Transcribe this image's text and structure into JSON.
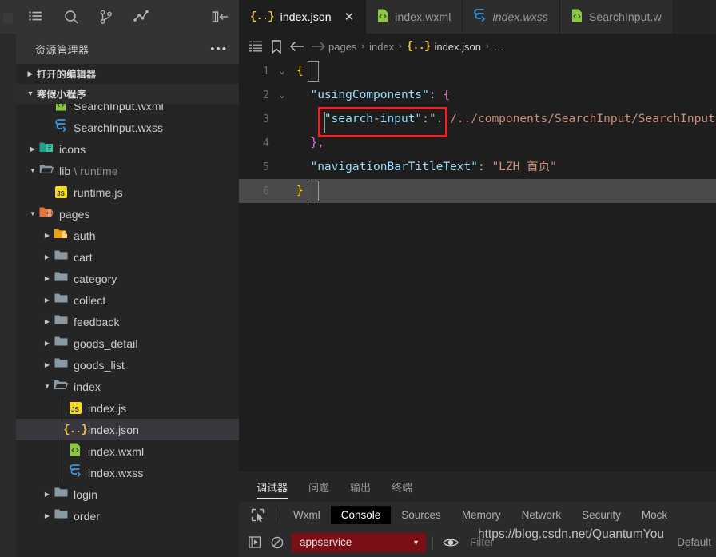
{
  "activity_bar": {
    "icons": [
      {
        "name": "explorer-icon",
        "glyph": "list"
      },
      {
        "name": "search-icon",
        "glyph": "magnifier"
      },
      {
        "name": "source-control-icon",
        "glyph": "branch"
      },
      {
        "name": "run-debug-icon",
        "glyph": "graph"
      }
    ],
    "collapse_label": "collapse-sidebar-icon"
  },
  "sidebar": {
    "title": "资源管理器",
    "more_actions": "•••",
    "sections": [
      {
        "label": "打开的编辑器",
        "expanded": false
      },
      {
        "label": "寒假小程序",
        "expanded": true
      }
    ],
    "tree": [
      {
        "label": "SearchInput.wxml",
        "icon": "wxml",
        "depth": 3,
        "type": "file",
        "selected": false
      },
      {
        "label": "SearchInput.wxss",
        "icon": "wxss",
        "depth": 3,
        "type": "file",
        "selected": false
      },
      {
        "label": "icons",
        "icon": "folder-icons",
        "depth": 2,
        "type": "folder",
        "expanded": false,
        "selected": false
      },
      {
        "label": "lib",
        "suffix": " \\ runtime",
        "icon": "folder-open",
        "depth": 2,
        "type": "folder",
        "expanded": true,
        "selected": false
      },
      {
        "label": "runtime.js",
        "icon": "js",
        "depth": 3,
        "type": "file",
        "selected": false
      },
      {
        "label": "pages",
        "icon": "folder-pages",
        "depth": 2,
        "type": "folder",
        "expanded": true,
        "selected": false
      },
      {
        "label": "auth",
        "icon": "folder-auth",
        "depth": 3,
        "type": "folder",
        "expanded": false,
        "selected": false
      },
      {
        "label": "cart",
        "icon": "folder",
        "depth": 3,
        "type": "folder",
        "expanded": false,
        "selected": false
      },
      {
        "label": "category",
        "icon": "folder",
        "depth": 3,
        "type": "folder",
        "expanded": false,
        "selected": false
      },
      {
        "label": "collect",
        "icon": "folder",
        "depth": 3,
        "type": "folder",
        "expanded": false,
        "selected": false
      },
      {
        "label": "feedback",
        "icon": "folder",
        "depth": 3,
        "type": "folder",
        "expanded": false,
        "selected": false
      },
      {
        "label": "goods_detail",
        "icon": "folder",
        "depth": 3,
        "type": "folder",
        "expanded": false,
        "selected": false
      },
      {
        "label": "goods_list",
        "icon": "folder",
        "depth": 3,
        "type": "folder",
        "expanded": false,
        "selected": false
      },
      {
        "label": "index",
        "icon": "folder-open",
        "depth": 3,
        "type": "folder",
        "expanded": true,
        "selected": false
      },
      {
        "label": "index.js",
        "icon": "js",
        "depth": 4,
        "type": "file",
        "selected": false
      },
      {
        "label": "index.json",
        "icon": "json",
        "depth": 4,
        "type": "file",
        "selected": true
      },
      {
        "label": "index.wxml",
        "icon": "wxml",
        "depth": 4,
        "type": "file",
        "selected": false
      },
      {
        "label": "index.wxss",
        "icon": "wxss",
        "depth": 4,
        "type": "file",
        "selected": false
      },
      {
        "label": "login",
        "icon": "folder",
        "depth": 3,
        "type": "folder",
        "expanded": false,
        "selected": false
      },
      {
        "label": "order",
        "icon": "folder",
        "depth": 3,
        "type": "folder",
        "expanded": false,
        "selected": false
      }
    ]
  },
  "editor": {
    "tabs": [
      {
        "label": "index.json",
        "icon": "json",
        "active": true,
        "italic": false,
        "closable": true
      },
      {
        "label": "index.wxml",
        "icon": "wxml",
        "active": false,
        "italic": false,
        "closable": false
      },
      {
        "label": "index.wxss",
        "icon": "wxss",
        "active": false,
        "italic": true,
        "closable": false
      },
      {
        "label": "SearchInput.w",
        "icon": "wxml",
        "active": false,
        "italic": false,
        "closable": false
      }
    ],
    "close_glyph": "✕",
    "breadcrumb": {
      "icons": [
        "outline-icon",
        "bookmark-icon",
        "back-arrow-icon",
        "forward-arrow-icon"
      ],
      "segments": [
        "pages",
        "index",
        "index.json",
        "…"
      ],
      "separator": "›"
    },
    "lines": [
      {
        "num": "1",
        "fold": "⌄",
        "tokens": [
          {
            "t": "{",
            "c": "t-brace"
          }
        ]
      },
      {
        "num": "2",
        "fold": "⌄",
        "tokens": [
          {
            "t": "  ",
            "c": "t-punc"
          },
          {
            "t": "\"usingComponents\"",
            "c": "t-key"
          },
          {
            "t": ": ",
            "c": "t-punc"
          },
          {
            "t": "{",
            "c": "t-brace2"
          }
        ]
      },
      {
        "num": "3",
        "fold": "",
        "tokens": [
          {
            "t": "    ",
            "c": "t-punc"
          },
          {
            "t": "\"search-input\"",
            "c": "t-key"
          },
          {
            "t": ":",
            "c": "t-punc"
          },
          {
            "t": "\"../../components/SearchInput/SearchInput\"",
            "c": "t-str"
          }
        ]
      },
      {
        "num": "4",
        "fold": "",
        "tokens": [
          {
            "t": "  ",
            "c": "t-punc"
          },
          {
            "t": "}",
            "c": "t-brace2"
          },
          {
            "t": ",",
            "c": "t-brace2"
          }
        ]
      },
      {
        "num": "5",
        "fold": "",
        "tokens": [
          {
            "t": "  ",
            "c": "t-punc"
          },
          {
            "t": "\"navigationBarTitleText\"",
            "c": "t-key"
          },
          {
            "t": ": ",
            "c": "t-punc"
          },
          {
            "t": "\"LZH_首页\"",
            "c": "t-str"
          }
        ]
      },
      {
        "num": "6",
        "fold": "",
        "current": true,
        "tokens": [
          {
            "t": "}",
            "c": "t-brace"
          }
        ]
      }
    ]
  },
  "panel": {
    "tabs": [
      {
        "label": "调试器",
        "active": true
      },
      {
        "label": "问题",
        "active": false
      },
      {
        "label": "输出",
        "active": false
      },
      {
        "label": "终端",
        "active": false
      }
    ],
    "devtools": {
      "inspect_icon": "inspect-element-icon",
      "tabs": [
        {
          "label": "Wxml",
          "active": false
        },
        {
          "label": "Console",
          "active": true
        },
        {
          "label": "Sources",
          "active": false
        },
        {
          "label": "Memory",
          "active": false
        },
        {
          "label": "Network",
          "active": false
        },
        {
          "label": "Security",
          "active": false
        },
        {
          "label": "Mock",
          "active": false
        }
      ],
      "toolbar": {
        "execute_icon": "execute-icon",
        "clear_icon": "clear-console-icon",
        "context_value": "appservice",
        "context_caret": "▼",
        "eye_icon": "live-expression-icon",
        "filter_placeholder": "Filter",
        "level_value": "Default"
      }
    }
  },
  "watermark": "https://blog.csdn.net/QuantumYou",
  "colors": {
    "accent_red": "#e8252a",
    "context_select_bg": "#7a1016",
    "editor_bg": "#1e1e1e",
    "sidebar_bg": "#252526",
    "selection_bg": "#37373d",
    "string": "#ce9178",
    "key": "#9cdcfe",
    "brace_yellow": "#ffd700",
    "brace_magenta": "#da70d6"
  }
}
